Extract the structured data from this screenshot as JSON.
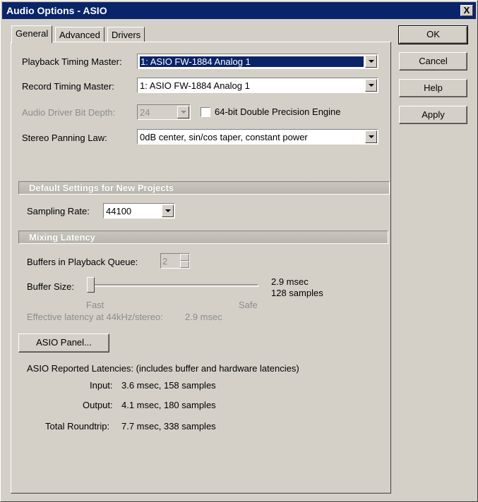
{
  "window": {
    "title": "Audio Options - ASIO",
    "close_glyph": "X"
  },
  "tabs": [
    {
      "label": "General",
      "active": true
    },
    {
      "label": "Advanced",
      "active": false
    },
    {
      "label": "Drivers",
      "active": false
    }
  ],
  "general": {
    "playback_timing_master": {
      "label": "Playback Timing Master:",
      "value": "1: ASIO FW-1884 Analog 1"
    },
    "record_timing_master": {
      "label": "Record Timing Master:",
      "value": "1: ASIO FW-1884 Analog 1"
    },
    "bit_depth": {
      "label": "Audio Driver Bit Depth:",
      "value": "24"
    },
    "double_precision": {
      "label": "64-bit Double Precision Engine",
      "checked": false
    },
    "stereo_panning_law": {
      "label": "Stereo Panning Law:",
      "value": "0dB center, sin/cos taper, constant power"
    }
  },
  "defaults_section": {
    "heading": "Default Settings for New Projects",
    "sampling_rate": {
      "label": "Sampling Rate:",
      "value": "44100"
    }
  },
  "mixing_latency": {
    "heading": "Mixing Latency",
    "buffers": {
      "label": "Buffers in Playback Queue:",
      "value": "2"
    },
    "buffer_size": {
      "label": "Buffer Size:",
      "readout_msec": "2.9 msec",
      "readout_samples": "128 samples",
      "fast_label": "Fast",
      "safe_label": "Safe",
      "position": 0.0
    },
    "effective_latency": {
      "label": "Effective latency at 44kHz/stereo:",
      "value": "2.9 msec"
    }
  },
  "asio_panel_button": "ASIO Panel...",
  "reported": {
    "heading": "ASIO Reported Latencies: (includes buffer and hardware latencies)",
    "input": {
      "label": "Input:",
      "value": "3.6 msec, 158 samples"
    },
    "output": {
      "label": "Output:",
      "value": "4.1 msec, 180 samples"
    },
    "roundtrip": {
      "label": "Total Roundtrip:",
      "value": "7.7 msec, 338 samples"
    }
  },
  "dialog_buttons": {
    "ok": "OK",
    "cancel": "Cancel",
    "help": "Help",
    "apply": "Apply"
  }
}
